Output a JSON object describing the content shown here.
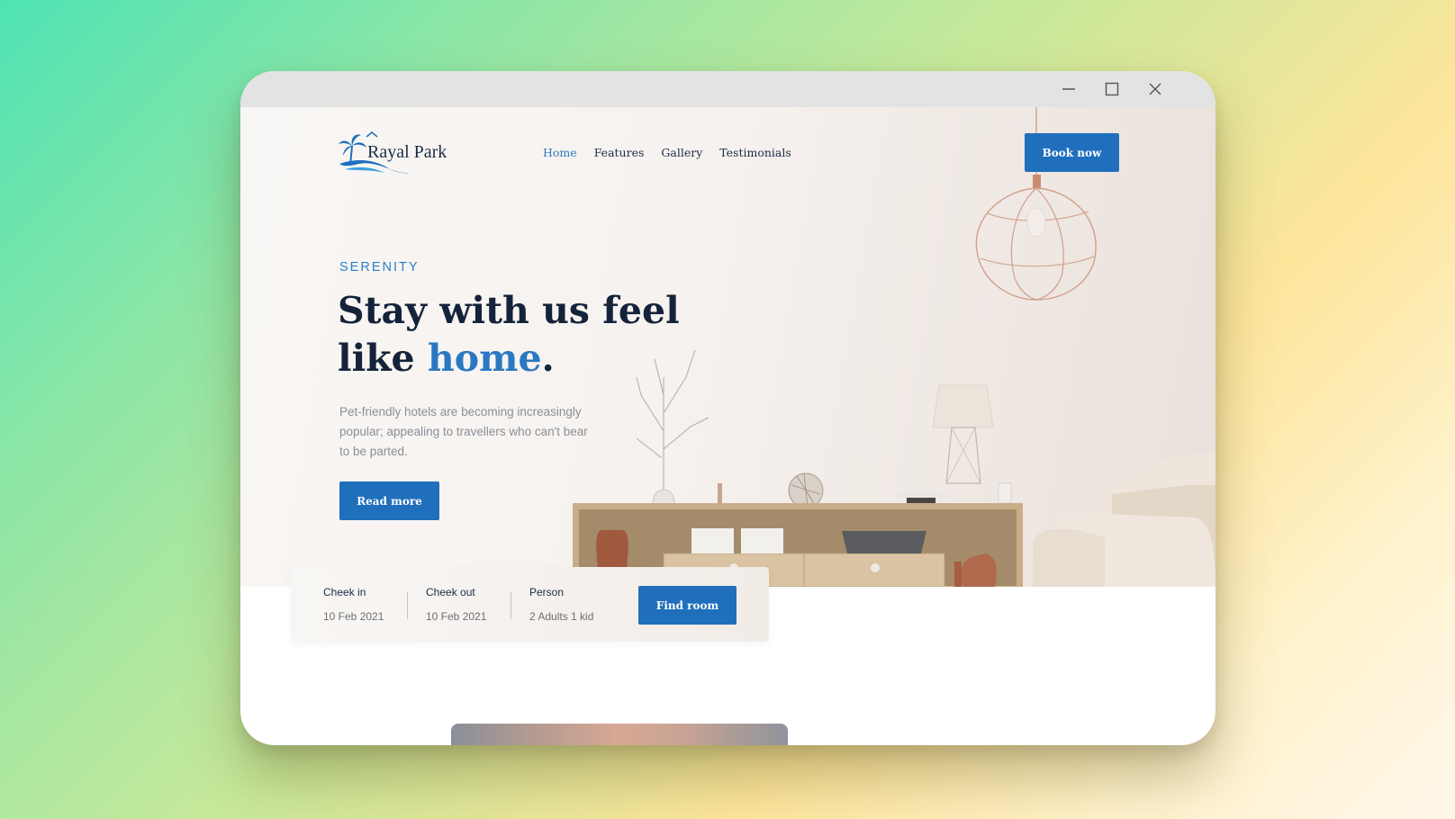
{
  "window": {
    "controls": [
      "minimize-icon",
      "maximize-icon",
      "close-icon"
    ]
  },
  "brand": {
    "name": "Rayal Park",
    "logo_icon": "palm-tree-wave-icon",
    "primary_color": "#1f6fbd",
    "accent_color": "#2a78c2",
    "heading_color": "#14233a"
  },
  "nav": {
    "items": [
      {
        "label": "Home",
        "active": true
      },
      {
        "label": "Features",
        "active": false
      },
      {
        "label": "Gallery",
        "active": false
      },
      {
        "label": "Testimonials",
        "active": false
      }
    ],
    "cta_label": "Book now"
  },
  "hero": {
    "eyebrow": "SERENITY",
    "headline_line1": "Stay with us feel",
    "headline_line2_prefix": "like ",
    "headline_highlight": "home",
    "headline_end": ".",
    "description": "Pet-friendly hotels are becoming increasingly popular; appealing to travellers who can't bear to be parted.",
    "read_more_label": "Read more"
  },
  "booking": {
    "check_in": {
      "label": "Cheek in",
      "value": "10 Feb 2021"
    },
    "check_out": {
      "label": "Cheek out",
      "value": "10 Feb 2021"
    },
    "person": {
      "label": "Person",
      "value": "2 Adults 1 kid"
    },
    "find_label": "Find room"
  }
}
